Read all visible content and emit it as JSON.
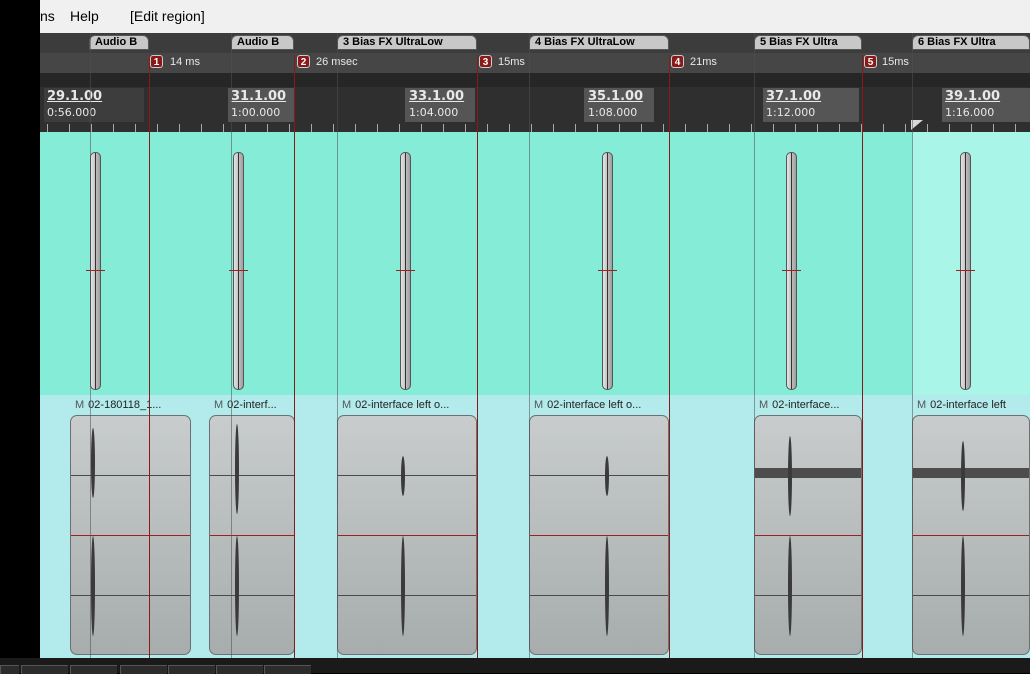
{
  "menubar": {
    "items": [
      {
        "label": "ns"
      },
      {
        "label": "Help"
      },
      {
        "label": "[Edit region]"
      }
    ]
  },
  "regions": [
    {
      "label": "Audio B"
    },
    {
      "label": "Audio B"
    },
    {
      "label": "3  Bias FX UltraLow"
    },
    {
      "label": "4  Bias FX UltraLow"
    },
    {
      "label": "5  Bias FX Ultra"
    },
    {
      "label": "6  Bias FX Ultra"
    }
  ],
  "markers": [
    {
      "num": "1",
      "text": "14 ms"
    },
    {
      "num": "2",
      "text": "26 msec"
    },
    {
      "num": "3",
      "text": "15ms"
    },
    {
      "num": "4",
      "text": "21ms"
    },
    {
      "num": "5",
      "text": "15ms"
    }
  ],
  "ruler": [
    {
      "beat": "29.1.00",
      "time": "0:56.000"
    },
    {
      "beat": "31.1.00",
      "time": "1:00.000"
    },
    {
      "beat": "33.1.00",
      "time": "1:04.000"
    },
    {
      "beat": "35.1.00",
      "time": "1:08.000"
    },
    {
      "beat": "37.1.00",
      "time": "1:12.000"
    },
    {
      "beat": "39.1.00",
      "time": "1:16.000"
    }
  ],
  "items": [
    {
      "mute": "M",
      "label": "02-180118_1..."
    },
    {
      "mute": "M",
      "label": "02-interf..."
    },
    {
      "mute": "M",
      "label": "02-interface left o..."
    },
    {
      "mute": "M",
      "label": "02-interface left o..."
    },
    {
      "mute": "M",
      "label": "02-interface..."
    },
    {
      "mute": "M",
      "label": "02-interface left"
    }
  ],
  "colors": {
    "envelope_lane": "#85ecd8",
    "item_lane": "#b3ebec",
    "marker": "#8a1a1a",
    "edit_cursor": "#a02020"
  }
}
